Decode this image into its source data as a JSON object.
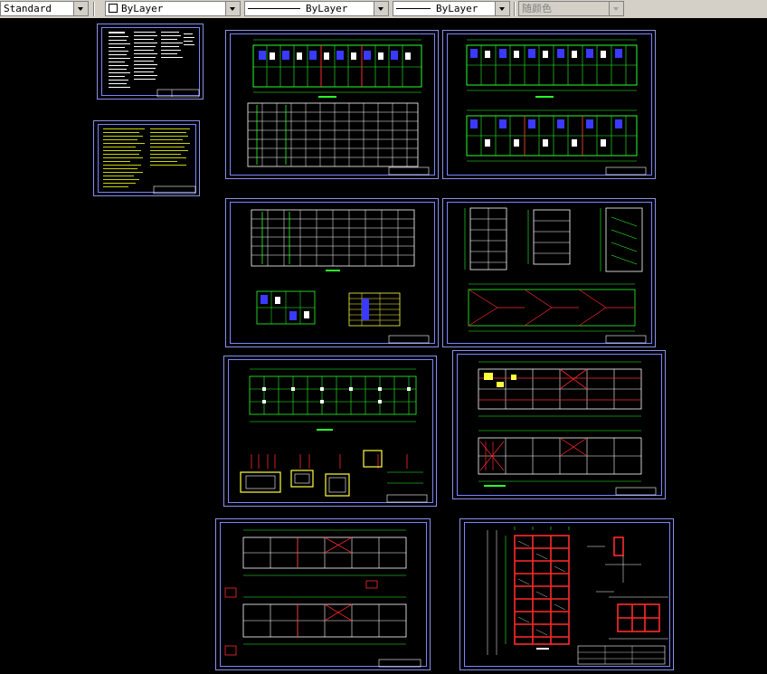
{
  "toolbar": {
    "style_combo": "Standard",
    "color_combo": "ByLayer",
    "linetype_combo": "ByLayer",
    "lineweight_combo": "ByLayer",
    "plotstyle_combo": "随颜色"
  },
  "colors": {
    "background": "#000000",
    "frame": "#7b84ff",
    "green": "#2aff2a",
    "red": "#ff2a2a",
    "blue": "#3a3aff",
    "white": "#ffffff",
    "yellow": "#ffff40",
    "olive": "#c8d400"
  }
}
